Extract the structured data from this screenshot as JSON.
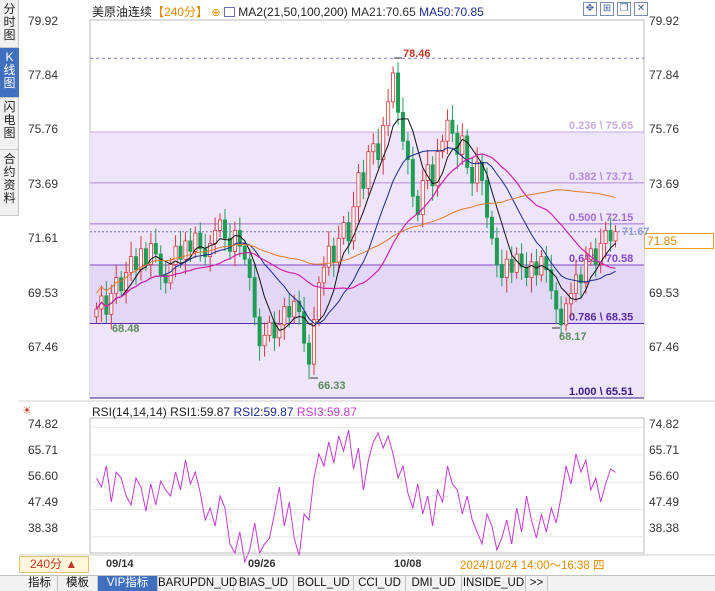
{
  "left_tabs": [
    "分时图",
    "K线图",
    "闪电图",
    "合约资料"
  ],
  "header": {
    "name": "美原油连续",
    "period_tag": "【240分】",
    "ma_label": "MA2(21,50,100,200)",
    "ma21": "MA21:70.65",
    "ma50": "MA50:70.85"
  },
  "price_axis": [
    "79.92",
    "77.84",
    "75.76",
    "73.69",
    "71.61",
    "69.53",
    "67.46"
  ],
  "rsi_axis": [
    "74.82",
    "65.71",
    "56.60",
    "47.49",
    "38.38"
  ],
  "current_price": "71.85",
  "annotations": {
    "high": "78.46",
    "low_left": "68.48",
    "low_mid": "66.33",
    "low_right": "68.17",
    "last_tag": "71.67"
  },
  "fib_levels": [
    {
      "label": "0.236 \\ 75.65",
      "price": 75.65,
      "color": "#c9a9e3"
    },
    {
      "label": "0.382 \\ 73.71",
      "price": 73.71,
      "color": "#b48ad8"
    },
    {
      "label": "0.500 \\ 72.15",
      "price": 72.15,
      "color": "#9f6fd0"
    },
    {
      "label": "0.618 \\ 70.58",
      "price": 70.58,
      "color": "#8045c4"
    },
    {
      "label": "0.786 \\ 68.35",
      "price": 68.35,
      "color": "#5a2aa0"
    },
    {
      "label": "1.000 \\ 65.51",
      "price": 65.51,
      "color": "#3a1a80"
    }
  ],
  "rsi_header": {
    "title": "RSI(14,14,14)",
    "rsi1": "RSI1:59.87",
    "rsi2": "RSI2:59.87",
    "rsi3": "RSI3:59.87"
  },
  "dates": [
    "09/14",
    "09/26",
    "10/08"
  ],
  "period_button": "240分 ▲",
  "status_time": "2024/10/24 14:00～16:38 四",
  "bottom_tabs": [
    "指标",
    "模板",
    "VIP指标",
    "BARUPDN_UD",
    "BIAS_UD",
    "BOLL_UD",
    "CCI_UD",
    "DMI_UD",
    "INSIDE_UD",
    ">>"
  ],
  "colors": {
    "up": "#d9363e",
    "down": "#1f9d55",
    "ma21": "#d61fa8",
    "ma50": "#1a2a8c",
    "ma100": "#e07a2c",
    "ma200": "#111111",
    "rsi": "#c23bd0",
    "fib_fill": "#ece2fb"
  },
  "chart_data": {
    "type": "candlestick",
    "series_close": [
      68.9,
      69.4,
      68.7,
      69.5,
      70.1,
      69.6,
      70.3,
      70.9,
      70.4,
      71.2,
      70.6,
      71.4,
      71.0,
      70.2,
      69.9,
      70.6,
      71.3,
      70.8,
      71.5,
      71.1,
      71.8,
      71.2,
      70.9,
      71.4,
      71.9,
      72.3,
      71.6,
      71.1,
      71.9,
      71.3,
      70.8,
      70.1,
      68.6,
      67.5,
      67.9,
      68.4,
      67.8,
      68.3,
      69.0,
      68.6,
      69.2,
      68.8,
      67.6,
      66.8,
      68.5,
      69.9,
      70.5,
      71.3,
      70.7,
      71.6,
      72.2,
      71.5,
      72.8,
      74.1,
      73.5,
      74.9,
      75.2,
      74.6,
      75.9,
      76.8,
      77.9,
      76.4,
      75.3,
      74.6,
      73.2,
      72.5,
      73.8,
      74.4,
      73.6,
      74.9,
      75.3,
      76.1,
      75.6,
      74.8,
      75.5,
      74.3,
      73.7,
      74.5,
      73.8,
      72.4,
      71.6,
      70.6,
      70.1,
      70.8,
      70.3,
      71.0,
      70.5,
      70.1,
      70.7,
      70.2,
      70.9,
      70.4,
      69.6,
      68.9,
      68.3,
      69.1,
      69.5,
      70.2,
      69.9,
      70.8,
      71.2,
      70.6,
      71.4,
      71.9,
      71.5,
      71.85
    ],
    "rsi": [
      58,
      55,
      62,
      50,
      60,
      58,
      52,
      49,
      58,
      55,
      47,
      56,
      49,
      57,
      54,
      52,
      60,
      54,
      64,
      56,
      60,
      53,
      44,
      48,
      42,
      52,
      48,
      36,
      33,
      40,
      30,
      34,
      43,
      33,
      36,
      38,
      46,
      55,
      42,
      50,
      38,
      32,
      46,
      44,
      58,
      66,
      62,
      70,
      63,
      72,
      67,
      74,
      61,
      68,
      54,
      64,
      70,
      73,
      68,
      72,
      66,
      58,
      62,
      53,
      48,
      56,
      46,
      52,
      42,
      54,
      50,
      62,
      56,
      54,
      46,
      52,
      44,
      40,
      36,
      46,
      42,
      34,
      38,
      44,
      36,
      48,
      40,
      52,
      44,
      38,
      46,
      40,
      48,
      43,
      52,
      62,
      56,
      66,
      60,
      64,
      54,
      58,
      50,
      56,
      61,
      59.87
    ],
    "ylim": [
      65.51,
      79.92
    ],
    "rsi_ylim": [
      33,
      78
    ]
  }
}
